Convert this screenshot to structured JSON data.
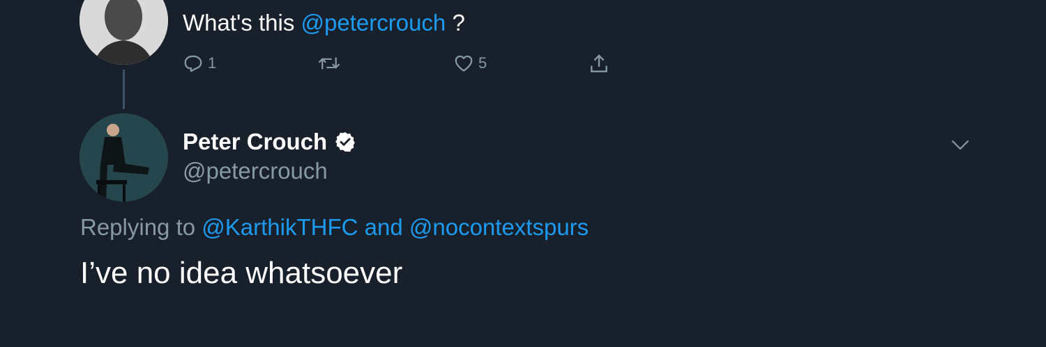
{
  "parent_tweet": {
    "text_before": "What's this",
    "mention": "@petercrouch",
    "text_after": "?",
    "actions": {
      "reply_count": "1",
      "retweet_count": "",
      "like_count": "5"
    }
  },
  "reply_tweet": {
    "author_name": "Peter Crouch",
    "author_handle": "@petercrouch",
    "replying_prefix": "Replying to",
    "replying_user_1": "@KarthikTHFC",
    "replying_and": "and",
    "replying_user_2": "@nocontextspurs",
    "text": "I’ve no idea whatsoever"
  },
  "icons": {
    "reply": "reply-icon",
    "retweet": "retweet-icon",
    "like": "heart-icon",
    "share": "share-icon",
    "verified": "verified-badge-icon",
    "more": "chevron-down-icon"
  },
  "colors": {
    "background": "#17202b",
    "accent": "#1d9bf0",
    "secondary_text": "#8899a6",
    "thread_line": "#3d5466"
  }
}
